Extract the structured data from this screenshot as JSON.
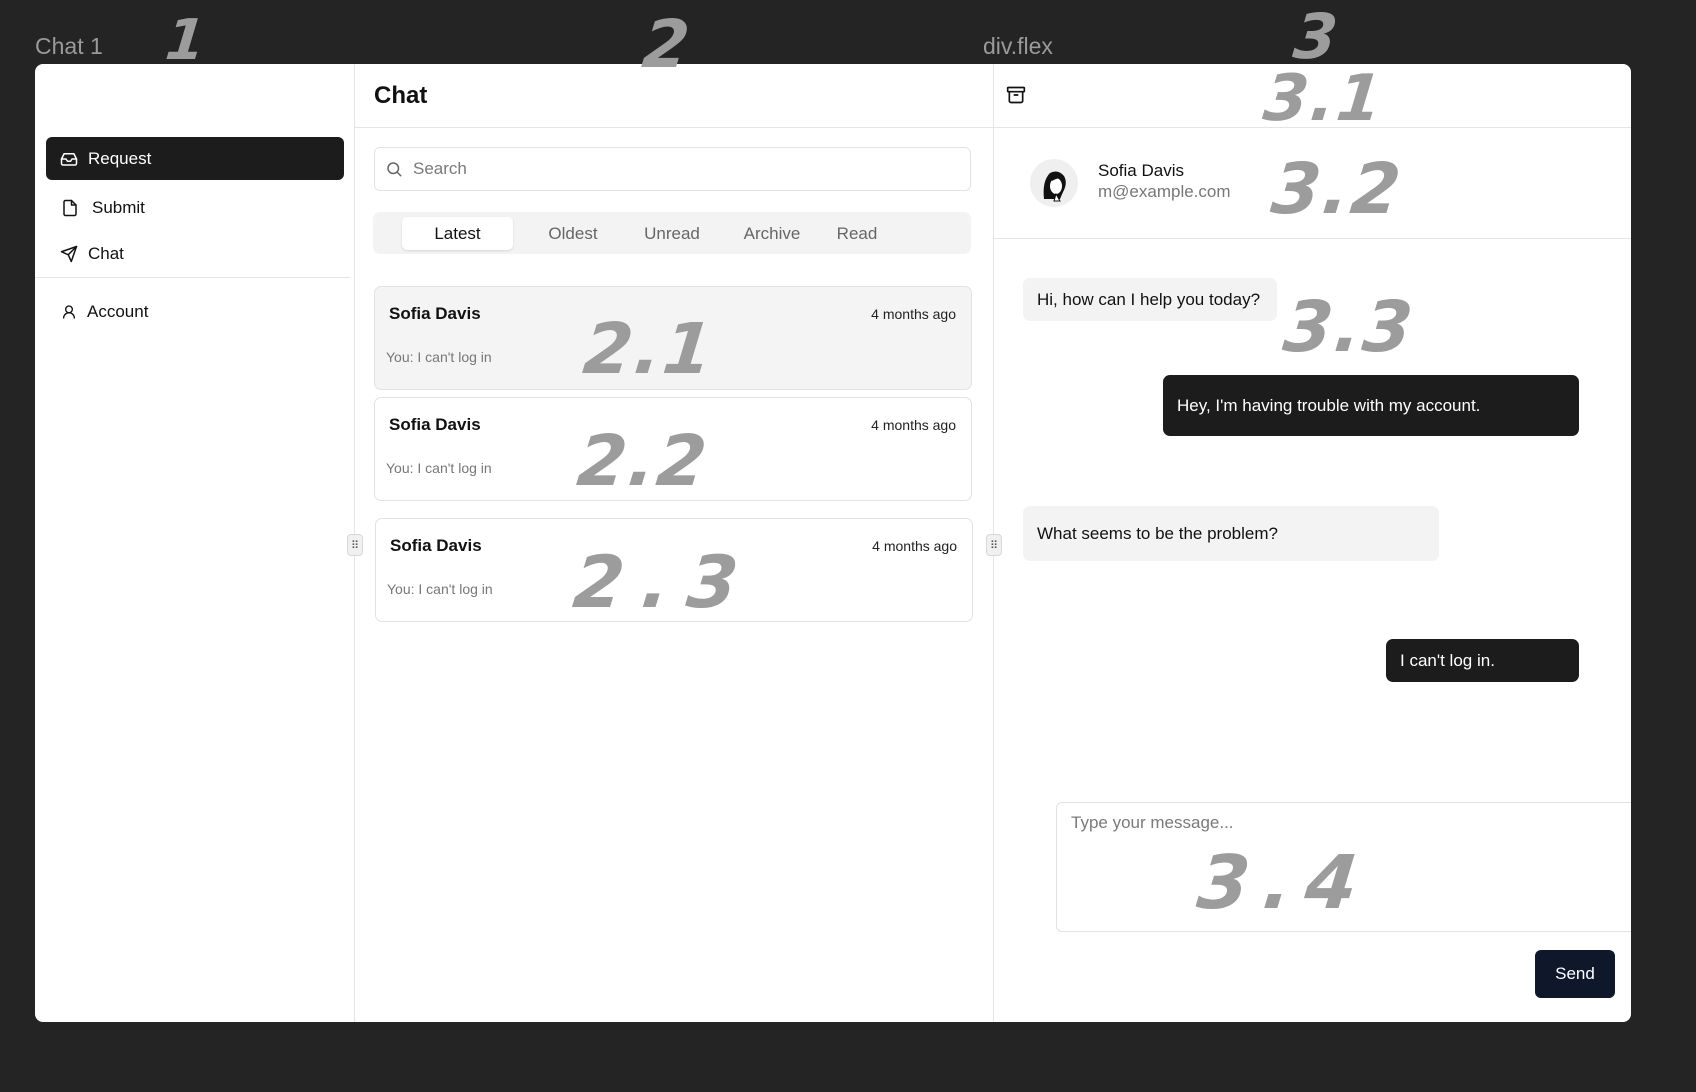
{
  "frame_labels": {
    "left": "Chat 1",
    "right": "div.flex"
  },
  "annotations": {
    "a1": "1",
    "a2": "2",
    "a3": "3",
    "a21": "2.1",
    "a22": "2.2",
    "a23": "2.3",
    "a31": "3.1",
    "a32": "3.2",
    "a33": "3.3",
    "a34": "3.4"
  },
  "sidebar": {
    "items": [
      {
        "label": "Request",
        "icon": "inbox-icon",
        "active": true
      },
      {
        "label": "Submit",
        "icon": "file-icon"
      },
      {
        "label": "Chat",
        "icon": "send-icon"
      },
      {
        "label": "Account",
        "icon": "user-icon"
      }
    ]
  },
  "middle": {
    "title": "Chat",
    "search_placeholder": "Search",
    "tabs": [
      "Latest",
      "Oldest",
      "Unread",
      "Archive",
      "Read"
    ],
    "active_tab": "Latest",
    "conversations": [
      {
        "name": "Sofia Davis",
        "time": "4 months ago",
        "preview": "You: I can't log in"
      },
      {
        "name": "Sofia Davis",
        "time": "4 months ago",
        "preview": "You: I can't log in"
      },
      {
        "name": "Sofia Davis",
        "time": "4 months ago",
        "preview": "You: I can't log in"
      }
    ]
  },
  "right": {
    "contact": {
      "name": "Sofia Davis",
      "email": "m@example.com"
    },
    "messages": [
      {
        "from": "them",
        "text": "Hi, how can I help you today?"
      },
      {
        "from": "me",
        "text": "Hey, I'm having trouble with my account."
      },
      {
        "from": "them",
        "text": "What seems to be the problem?"
      },
      {
        "from": "me",
        "text": "I can't log in."
      }
    ],
    "composer_placeholder": "Type your message...",
    "send_label": "Send"
  },
  "colors": {
    "active_bg": "#1c1c1c",
    "send_bg": "#0f172a",
    "canvas_bg": "#242424"
  }
}
